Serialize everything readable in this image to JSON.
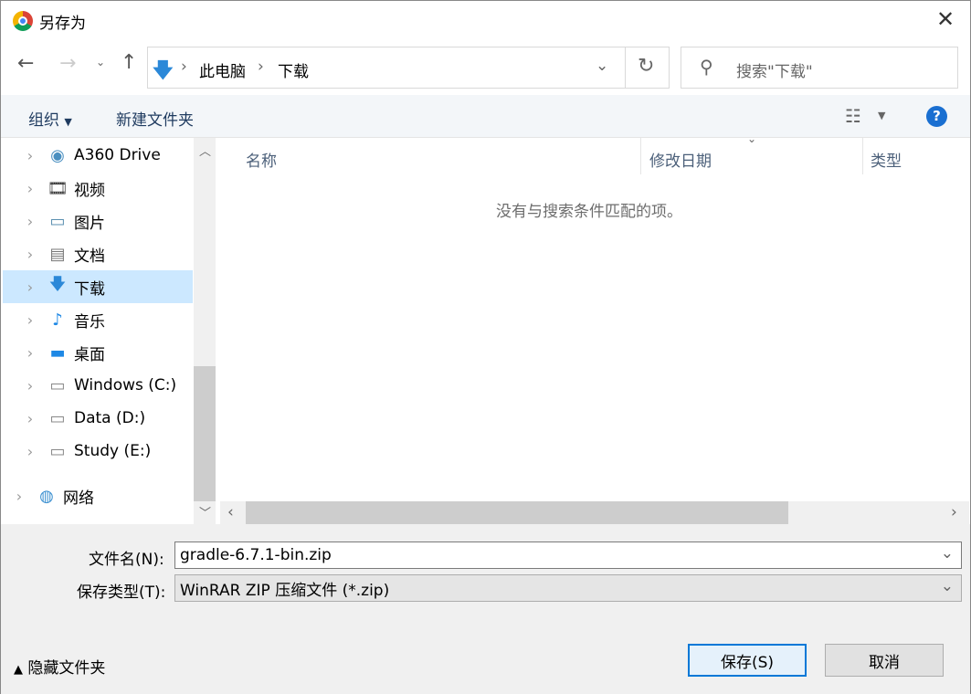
{
  "title": "另存为",
  "nav": {
    "path": [
      "此电脑",
      "下载"
    ],
    "search_placeholder": "搜索\"下载\""
  },
  "toolbar": {
    "organize": "组织",
    "new_folder": "新建文件夹"
  },
  "tree": [
    {
      "label": "A360 Drive",
      "icon": "a360-icon"
    },
    {
      "label": "视频",
      "icon": "video-icon"
    },
    {
      "label": "图片",
      "icon": "pictures-icon"
    },
    {
      "label": "文档",
      "icon": "documents-icon"
    },
    {
      "label": "下载",
      "icon": "download-icon",
      "selected": true
    },
    {
      "label": "音乐",
      "icon": "music-icon"
    },
    {
      "label": "桌面",
      "icon": "desktop-icon"
    },
    {
      "label": "Windows (C:)",
      "icon": "drive-icon"
    },
    {
      "label": "Data (D:)",
      "icon": "drive-icon"
    },
    {
      "label": "Study (E:)",
      "icon": "drive-icon"
    },
    {
      "label": "网络",
      "icon": "network-icon"
    }
  ],
  "columns": [
    "名称",
    "修改日期",
    "类型"
  ],
  "empty_message": "没有与搜索条件匹配的项。",
  "form": {
    "filename_label": "文件名(N):",
    "filename": "gradle-6.7.1-bin.zip",
    "type_label": "保存类型(T):",
    "type": "WinRAR ZIP 压缩文件 (*.zip)"
  },
  "footer": {
    "hide_folders": "隐藏文件夹",
    "save": "保存(S)",
    "cancel": "取消"
  },
  "colors": {
    "accent": "#0078d7",
    "selection": "#cce8ff"
  }
}
